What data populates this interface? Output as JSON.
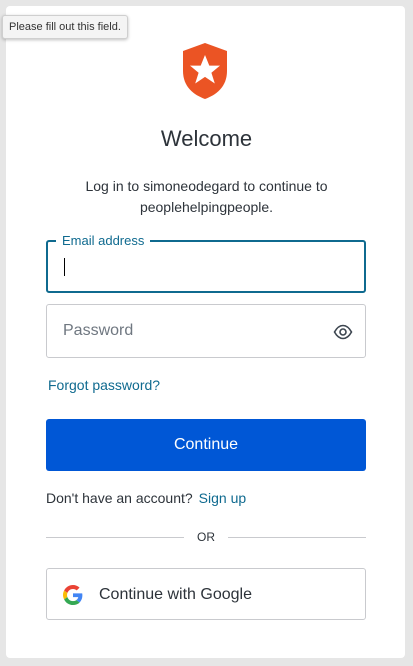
{
  "tooltip": {
    "text": "Please fill out this field."
  },
  "header": {
    "title": "Welcome",
    "subtitle": "Log in to simoneodegard to continue to peoplehelpingpeople."
  },
  "form": {
    "email_label": "Email address",
    "email_value": "",
    "password_placeholder": "Password",
    "forgot_label": "Forgot password?",
    "continue_label": "Continue"
  },
  "signup": {
    "prompt": "Don't have an account?",
    "link": "Sign up"
  },
  "divider": {
    "text": "OR"
  },
  "social": {
    "google_label": "Continue with Google"
  },
  "colors": {
    "accent": "#0057d6",
    "link": "#0f6a8f",
    "logo": "#eb5424"
  },
  "icons": {
    "logo": "auth0-shield-star-logo",
    "password_toggle": "eye-icon",
    "google": "google-g-icon"
  }
}
